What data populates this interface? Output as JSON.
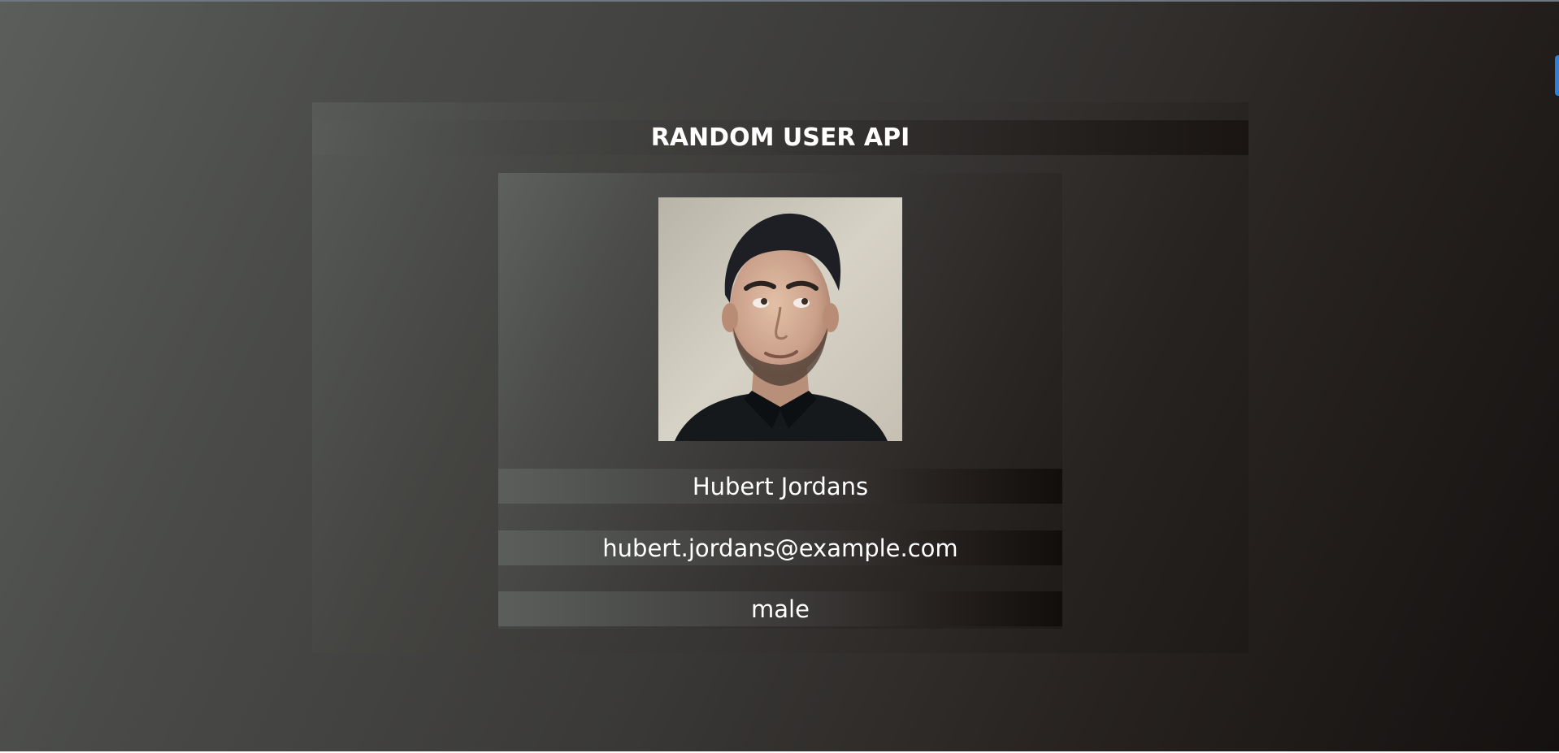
{
  "app": {
    "title": "RANDOM USER API"
  },
  "user": {
    "full_name": "Hubert Jordans",
    "email": "hubert.jordans@example.com",
    "gender": "male",
    "avatar_icon": "user-photo"
  },
  "colors": {
    "accent_tab": "#2f7fd3",
    "text": "#ffffff"
  }
}
